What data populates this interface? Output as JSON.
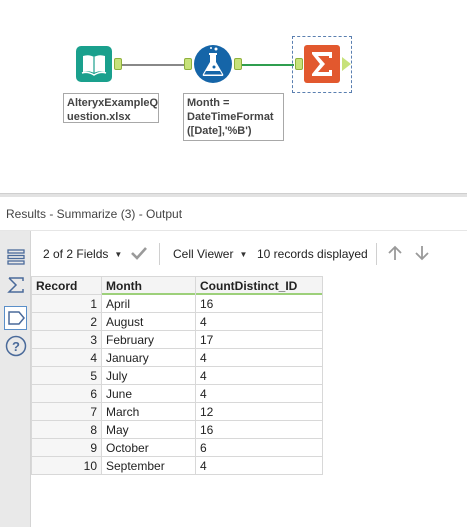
{
  "workflow": {
    "input_tool": {
      "icon": "book-icon",
      "color": "#1aa08d",
      "note": "AlteryxExampleQuestion.xlsx",
      "note_lines": [
        "AlteryxExampleQ",
        "uestion.xlsx"
      ]
    },
    "formula_tool": {
      "icon": "flask-icon",
      "color": "#1565a8",
      "note_lines": [
        "Month =",
        "DateTimeFormat",
        "([Date],'%B')"
      ]
    },
    "summarize_tool": {
      "icon": "sigma-icon",
      "color": "#e2582e"
    }
  },
  "results": {
    "title": "Results - Summarize (3) - Output",
    "fields_selector": "2 of 2 Fields",
    "viewer_selector": "Cell Viewer",
    "records_text": "10 records displayed",
    "columns": [
      "Record",
      "Month",
      "CountDistinct_ID"
    ],
    "rows": [
      {
        "record": "1",
        "month": "April",
        "count": "16"
      },
      {
        "record": "2",
        "month": "August",
        "count": "4"
      },
      {
        "record": "3",
        "month": "February",
        "count": "17"
      },
      {
        "record": "4",
        "month": "January",
        "count": "4"
      },
      {
        "record": "5",
        "month": "July",
        "count": "4"
      },
      {
        "record": "6",
        "month": "June",
        "count": "4"
      },
      {
        "record": "7",
        "month": "March",
        "count": "12"
      },
      {
        "record": "8",
        "month": "May",
        "count": "16"
      },
      {
        "record": "9",
        "month": "October",
        "count": "6"
      },
      {
        "record": "10",
        "month": "September",
        "count": "4"
      }
    ]
  },
  "sidebar": {
    "icons": [
      "list-icon",
      "sigma-outline-icon",
      "tag-icon",
      "help-icon"
    ]
  }
}
